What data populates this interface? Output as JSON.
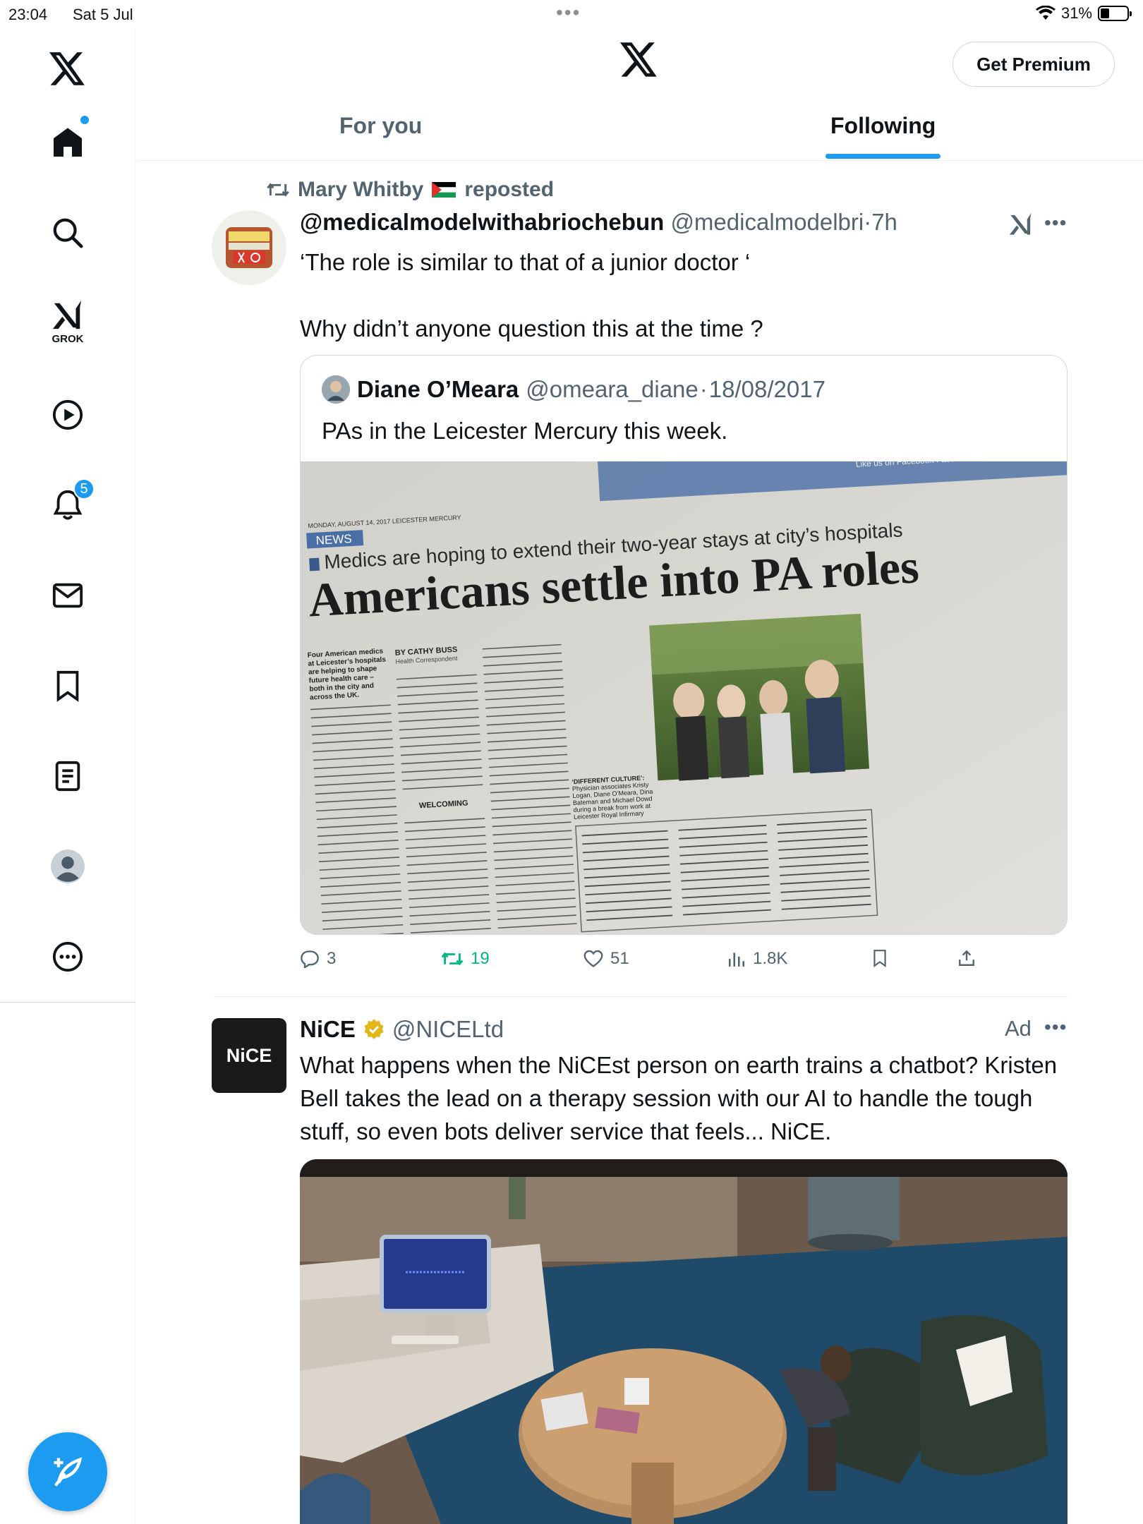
{
  "status_bar": {
    "time": "23:04",
    "date": "Sat 5 Jul",
    "battery": "31%",
    "battery_level": 0.31
  },
  "sidebar": {
    "grok_label": "GROK",
    "notifications_count": "5"
  },
  "header": {
    "premium_button": "Get Premium",
    "tabs": [
      {
        "label": "For you",
        "active": false
      },
      {
        "label": "Following",
        "active": true
      }
    ]
  },
  "tweet1": {
    "reposted_by": "Mary Whitby",
    "reposted_label": "reposted",
    "author_name": "@medicalmodelwithabriochebun",
    "author_handle": "@medicalmodelbri",
    "time": "7h",
    "text": "‘The role is similar to that of a junior doctor ‘\n\nWhy didn’t anyone question this at the time ?",
    "quote": {
      "author_name": "Diane O’Meara",
      "author_handle": "@omeara_diane",
      "date": "18/08/2017",
      "text": "PAs in the Leicester Mercury this week.",
      "newspaper": {
        "dateline": "MONDAY, AUGUST 14, 2017   LEICESTER MERCURY",
        "section": "NEWS",
        "facebook": "Like us on Facebook  Facebook.com/leicestermercury",
        "subheadline": "Medics are hoping to extend their two-year stays at city’s hospitals",
        "headline": "Americans settle into PA roles",
        "byline": "BY CATHY BUSS",
        "byline_role": "Health Correspondent",
        "intro": "Four American medics at Leicester’s hospitals are helping to shape future health care – both in the city and across the UK.",
        "welcoming": "WELCOMING",
        "caption_title": "‘DIFFERENT CULTURE’:",
        "caption": "Physician associates Kristy Logan, Diane O’Meara, Dina Bateman and Michael Dowd during a break from work at Leicester Royal Infirmary"
      }
    },
    "stats": {
      "replies": "3",
      "reposts": "19",
      "likes": "51",
      "views": "1.8K"
    }
  },
  "tweet2": {
    "author_name": "NiCE",
    "author_handle": "@NICELtd",
    "avatar_text": "NiCE",
    "ad_label": "Ad",
    "text": "What happens when the NiCEst person on earth trains a chatbot? Kristen Bell takes the lead on a therapy session with our AI to handle the tough stuff, so even bots deliver service that feels... NiCE."
  },
  "colors": {
    "accent": "#1d9bf0",
    "repost_green": "#00ba7c",
    "secondary_text": "#536471"
  }
}
